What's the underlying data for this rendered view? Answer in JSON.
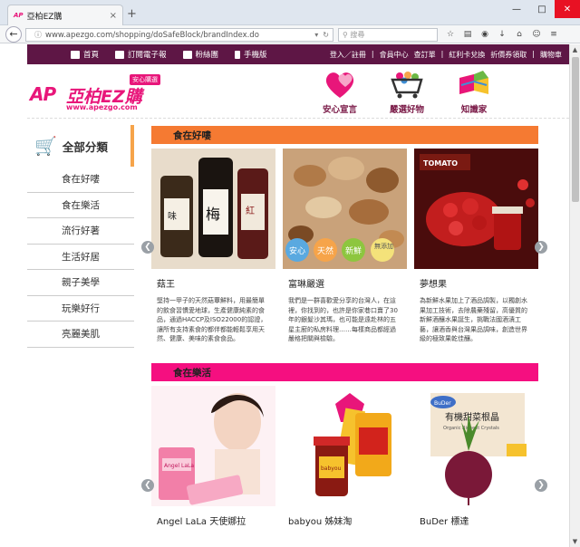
{
  "browser": {
    "tab_favicon": "AP",
    "tab_title": "亞柏EZ購",
    "tab_close": "×",
    "new_tab": "+",
    "url": "www.apezgo.com/shopping/doSafeBlock/brandIndex.do",
    "search_placeholder": "搜尋"
  },
  "site_nav": {
    "items": [
      {
        "label": "首頁"
      },
      {
        "label": "訂閱電子報"
      },
      {
        "label": "粉絲團"
      },
      {
        "label": "手機版"
      }
    ],
    "member_links": [
      "登入／註冊",
      "|",
      "會員中心",
      "查訂單",
      "|",
      "紅利卡兌換",
      "折價券領取",
      "|",
      "購物車"
    ]
  },
  "logo": {
    "ap": "AP",
    "name": "亞柏EZ購",
    "slogan": "安心購選",
    "url": "www.apezgo.com"
  },
  "features": [
    {
      "label": "安心宣言"
    },
    {
      "label": "嚴選好物"
    },
    {
      "label": "知識家"
    }
  ],
  "sidebar": {
    "title": "全部分類",
    "items": [
      {
        "label": "食在好嘍"
      },
      {
        "label": "食在樂活"
      },
      {
        "label": "流行好著"
      },
      {
        "label": "生活好居"
      },
      {
        "label": "親子美學"
      },
      {
        "label": "玩樂好行"
      },
      {
        "label": "亮麗美肌"
      }
    ]
  },
  "sections": [
    {
      "title": "食在好嘍",
      "cards": [
        {
          "title": "菇王",
          "desc": "堅持一甲子的天然菇蕈鮮料，用最簡單的飲食習慣愛地球，生產健康純素的食品，通過HACCP及ISO22000的認證，讓所有支持素食的都伴都能輕鬆享用天然、健康、美味的素食食品。",
          "badges": [
            "安心",
            "天然",
            "新鮮",
            "無添加"
          ]
        },
        {
          "title": "富琳嚴選",
          "desc": "我們是一群喜歡愛分享的台灣人，在這裡，你找到的，也許是你家巷口賣了30年的銀髮沙其瑪，也可能是遠赴林的五星主廚的私房料理……每樣商品都經過嚴格把關與檢驗。"
        },
        {
          "title": "夢想果",
          "desc": "為新鮮水果加上了酒品調製，以獨創水果加工技術，去除農藥殘留，高優質的新鮮酒釀水果誕生，挑戰法國酒漬工藝，讓酒香與台灣果品調味，創造世界級的極致果乾佳釀。",
          "brand": "TOMATO"
        }
      ]
    },
    {
      "title": "食在樂活",
      "cards": [
        {
          "title": "Angel LaLa 天使娜拉",
          "product": "Angel LaLa"
        },
        {
          "title": "babyou 姊妹淘",
          "product": "babyou"
        },
        {
          "title": "BuDer 標達",
          "product": "BuDer",
          "box_title": "有機甜菜根晶",
          "box_sub": "Organic Bioheet Crystals"
        }
      ]
    }
  ],
  "colors": {
    "brand_pink": "#e8167a",
    "sitebar_bg": "#5e1645",
    "section1_bar": "#f57a32",
    "section2_bar": "#f50f80",
    "sidebar_accent": "#f6a44a"
  }
}
